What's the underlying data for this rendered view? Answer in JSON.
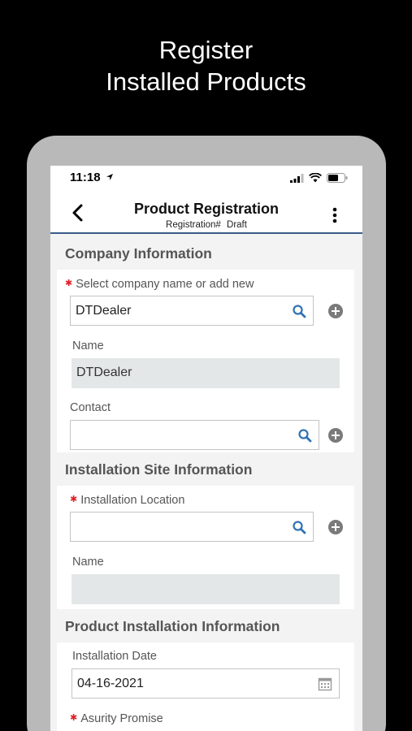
{
  "promo": {
    "line1": "Register",
    "line2": "Installed Products"
  },
  "status_bar": {
    "time": "11:18"
  },
  "nav": {
    "title": "Product Registration",
    "registration_label": "Registration#",
    "registration_status": "Draft",
    "back_icon": "chevron-left-icon",
    "menu_icon": "more-vertical-icon"
  },
  "company_info": {
    "header": "Company Information",
    "select_label": "Select company name or add new",
    "select_value": "DTDealer",
    "name_label": "Name",
    "name_value": "DTDealer",
    "contact_label": "Contact",
    "contact_value": ""
  },
  "installation_site": {
    "header": "Installation Site Information",
    "location_label": "Installation Location",
    "location_value": "",
    "name_label": "Name",
    "name_value": ""
  },
  "product_installation": {
    "header": "Product Installation Information",
    "date_label": "Installation Date",
    "date_value": "04-16-2021",
    "promise_label": "Asurity Promise"
  },
  "colors": {
    "accent": "#2f73b5",
    "nav_border": "#3b5a8a",
    "required": "#e0202a"
  }
}
